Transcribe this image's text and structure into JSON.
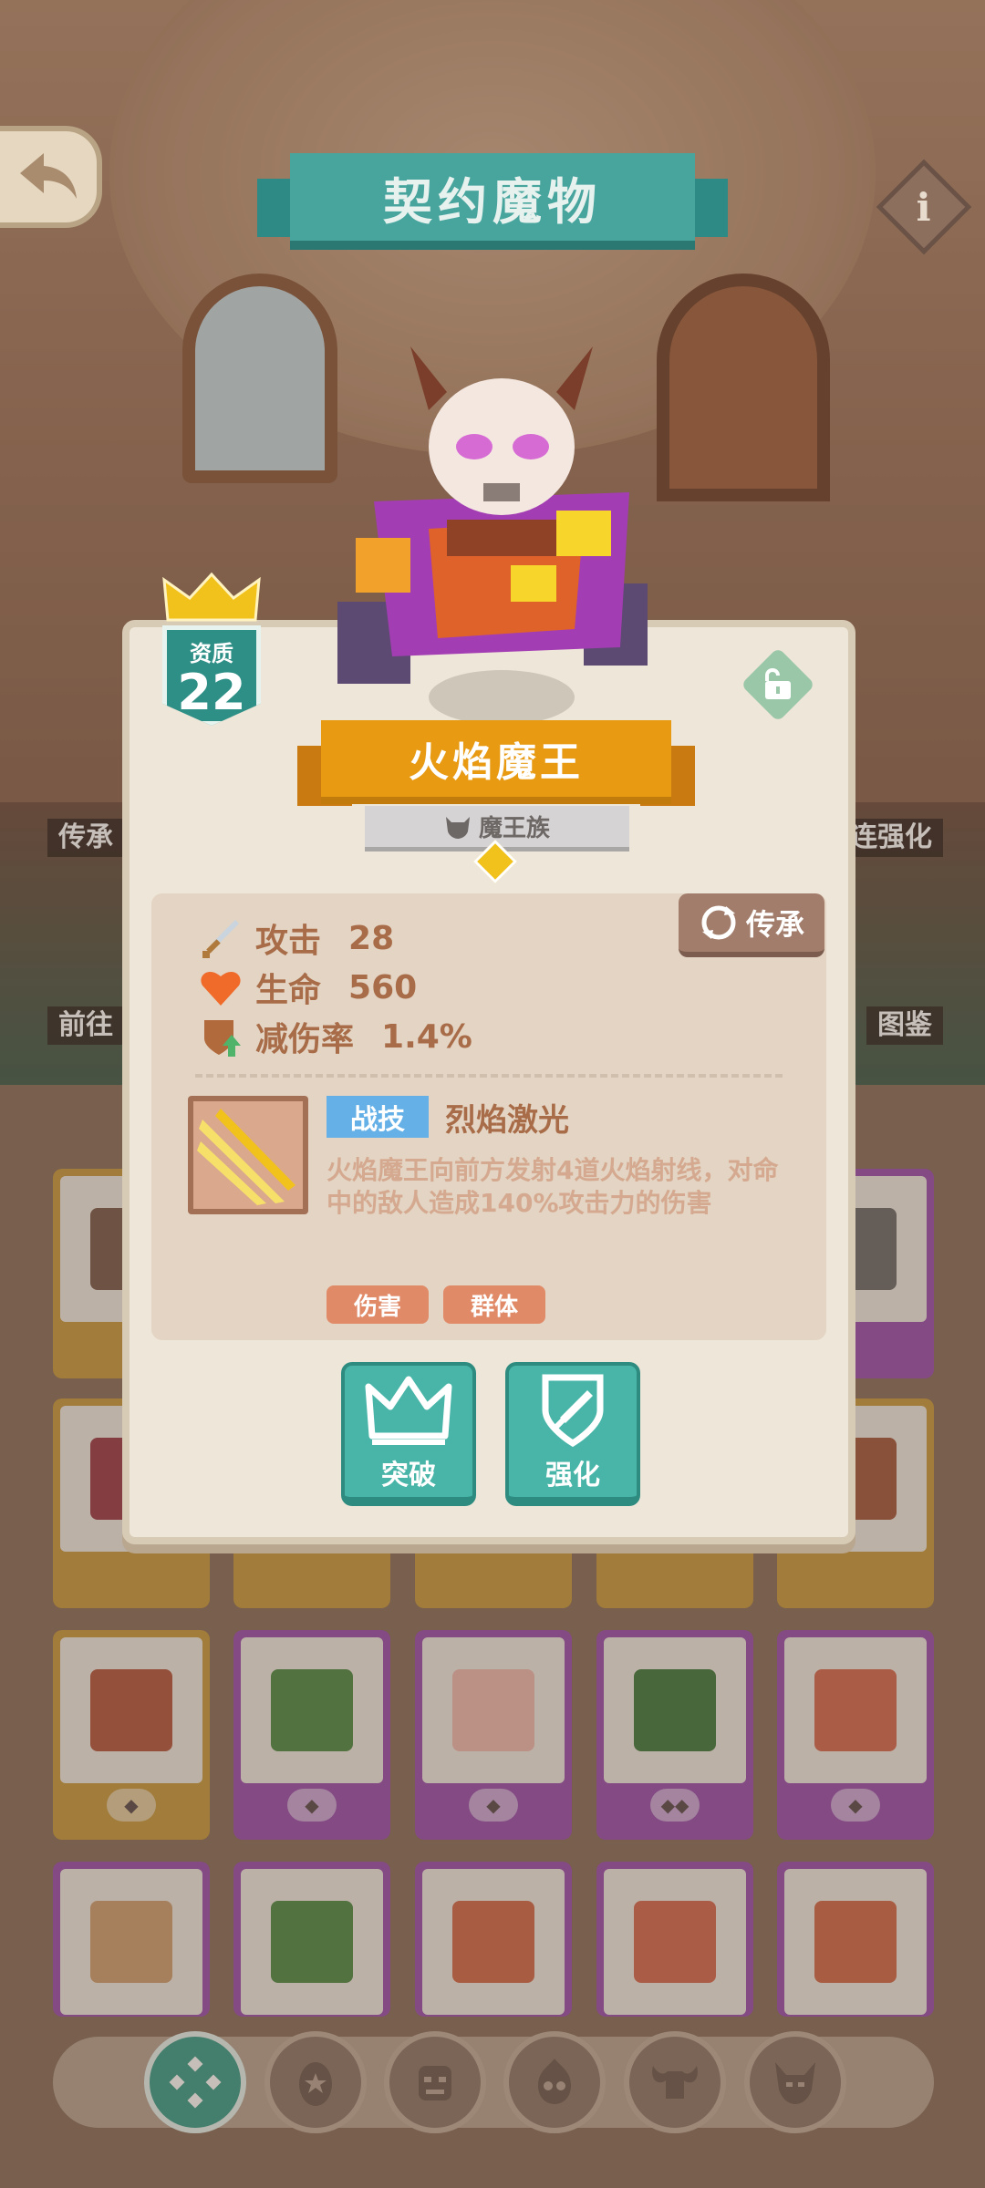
{
  "header": {
    "title": "契约魔物"
  },
  "scene": {
    "left_label_1": "传承",
    "left_label_2": "前往",
    "right_label_1": "连强化",
    "right_label_2": "图鉴"
  },
  "monster": {
    "name": "火焰魔王",
    "race": "魔王族",
    "quality_label": "资质",
    "quality_value": "22",
    "stars": 1
  },
  "stats": {
    "attack_label": "攻击",
    "attack_value": "28",
    "hp_label": "生命",
    "hp_value": "560",
    "dmg_reduction_label": "减伤率",
    "dmg_reduction_value": "1.4%"
  },
  "inherit_button": "传承",
  "skill": {
    "type": "战技",
    "name": "烈焰激光",
    "description": "火焰魔王向前方发射4道火焰射线，对命中的敌人造成140%攻击力的伤害",
    "tags": [
      "伤害",
      "群体"
    ]
  },
  "actions": {
    "breakthrough": "突破",
    "enhance": "强化"
  },
  "colors": {
    "teal": "#48b5a8",
    "orange": "#e79a12",
    "brown_text": "#a86c48",
    "skill_blue": "#65b1e7",
    "tag_orange": "#e08a68",
    "card_gold": "#c89a3d",
    "card_purple": "#9b4eae"
  },
  "nav": {
    "items": [
      "all-icon",
      "egg-icon",
      "orc-icon",
      "skull-fire-icon",
      "ram-horns-icon",
      "demon-icon"
    ],
    "active": "all-icon"
  }
}
